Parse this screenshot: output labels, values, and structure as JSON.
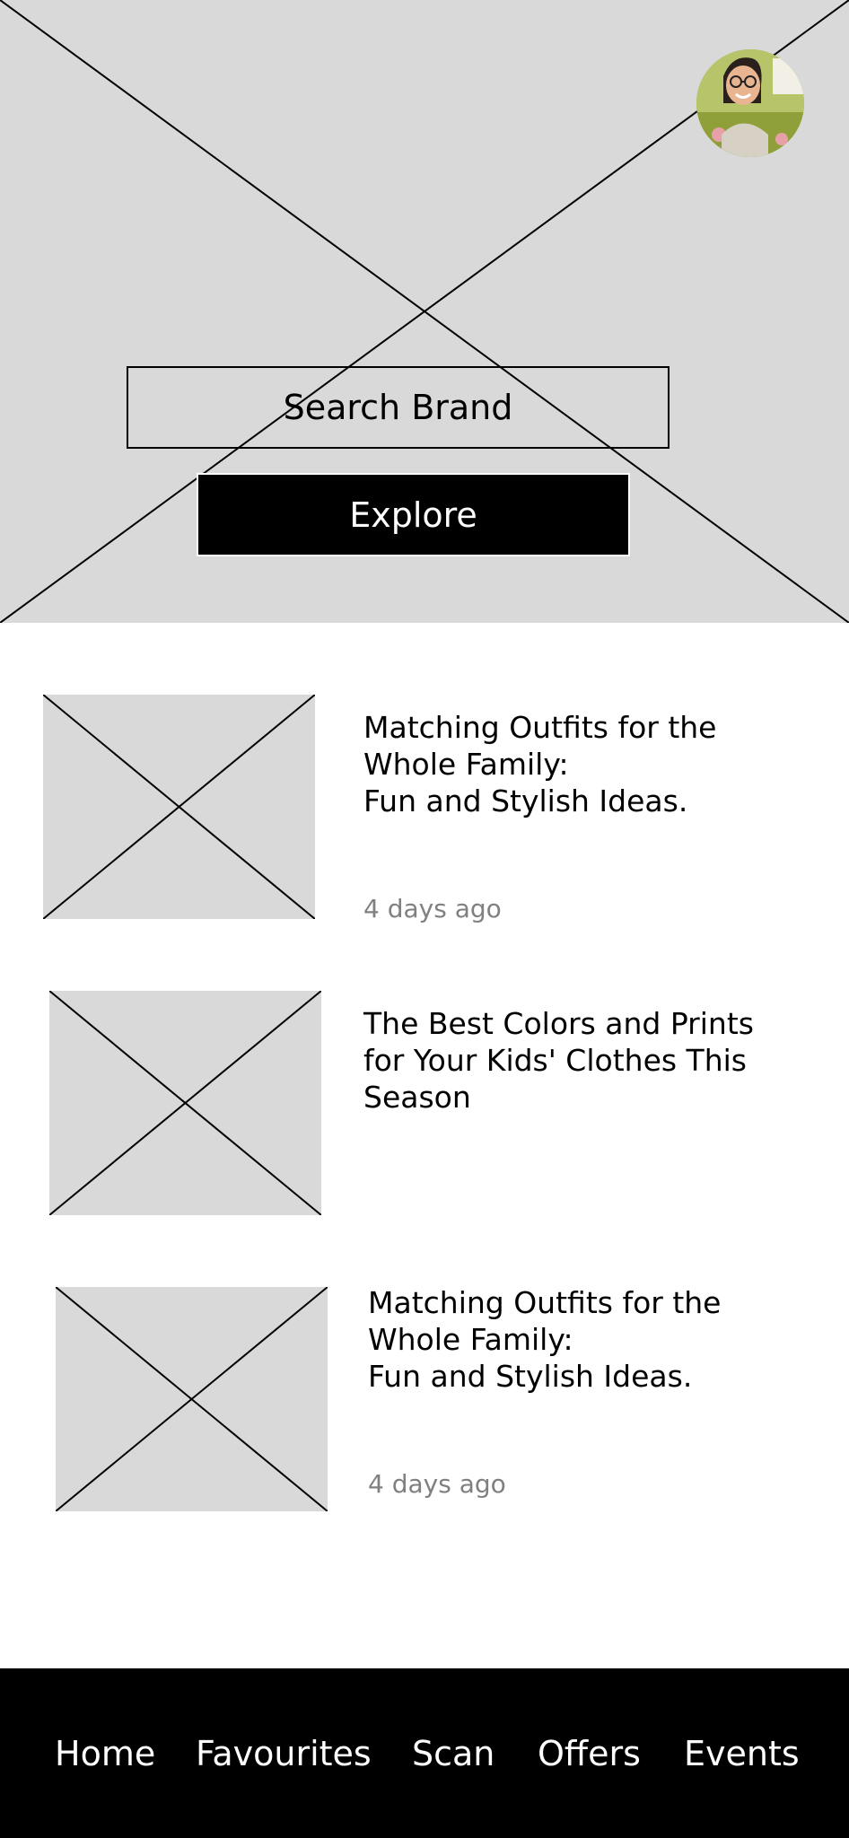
{
  "hero": {
    "image_icon": "image-placeholder-icon",
    "search_text": "Search Brand",
    "explore_label": "Explore"
  },
  "profile": {
    "avatar_icon": "user-avatar"
  },
  "articles": [
    {
      "title": "Matching Outfits for the\nWhole Family:\nFun and Stylish Ideas.",
      "time": "4 days ago"
    },
    {
      "title": "The Best Colors and Prints\nfor Your Kids' Clothes This\nSeason"
    },
    {
      "title": "Matching Outfits for the\nWhole Family:\nFun and Stylish Ideas.",
      "time": "4 days ago"
    }
  ],
  "nav": {
    "items": [
      {
        "label": "Home"
      },
      {
        "label": "Favourites"
      },
      {
        "label": "Scan"
      },
      {
        "label": "Offers"
      },
      {
        "label": "Events"
      }
    ]
  },
  "colors": {
    "placeholder_fill": "#d9d9d9",
    "nav_background": "#000000",
    "muted_text": "#808080"
  }
}
